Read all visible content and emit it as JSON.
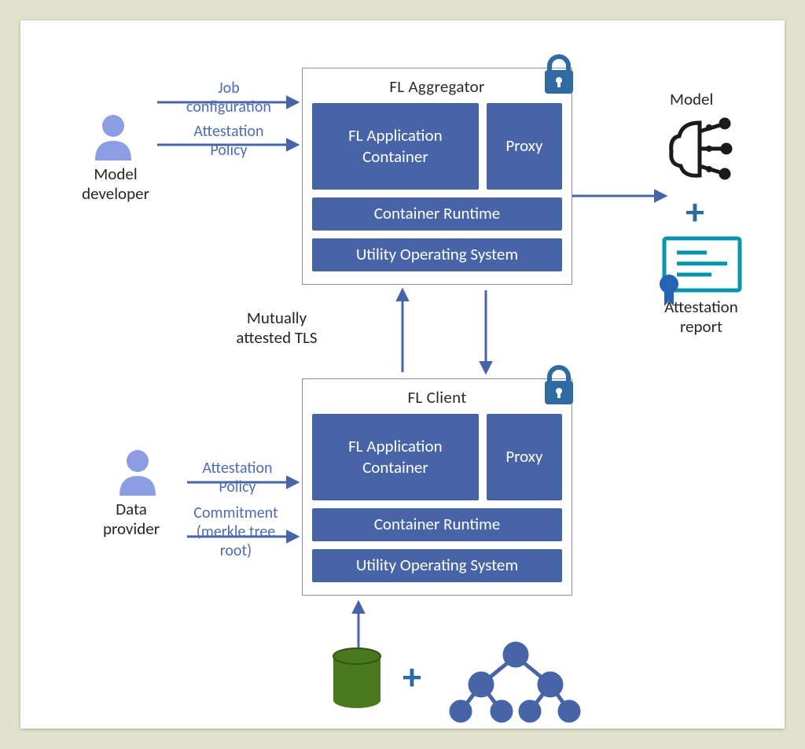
{
  "actors": {
    "model_developer": {
      "label": "Model\ndeveloper",
      "inputs": [
        "Job\nconfiguration",
        "Attestation\nPolicy"
      ]
    },
    "data_provider": {
      "label": "Data\nprovider",
      "inputs": [
        "Attestation\nPolicy",
        "Commitment\n(merkle tree\nroot)"
      ]
    }
  },
  "containers": {
    "aggregator": {
      "title": "FL Aggregator",
      "blocks": {
        "app": "FL Application\nContainer",
        "proxy": "Proxy",
        "runtime": "Container Runtime",
        "os": "Utility Operating System"
      }
    },
    "client": {
      "title": "FL Client",
      "blocks": {
        "app": "FL Application\nContainer",
        "proxy": "Proxy",
        "runtime": "Container Runtime",
        "os": "Utility Operating System"
      }
    }
  },
  "links": {
    "tls": "Mutually\nattested TLS"
  },
  "outputs": {
    "model": "Model",
    "report": "Attestation\nreport"
  },
  "bottom_inputs": {
    "plus": "+"
  },
  "plus": "+"
}
